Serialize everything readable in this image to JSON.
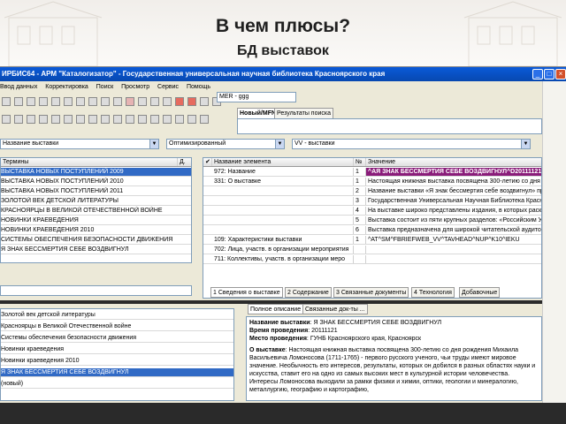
{
  "slide": {
    "title": "В чем плюсы?",
    "subtitle": "БД выставок"
  },
  "window": {
    "title": "ИРБИС64 - АРМ \"Каталогизатор\" - Государственная универсальная научная библиотека Красноярского края"
  },
  "menu": [
    "Ввод данных",
    "Корректировка",
    "Поиск",
    "Просмотр",
    "Сервис",
    "Помощь"
  ],
  "toolbar": {
    "db_field": "MER - ggg",
    "tab_new": "Новый/MFN",
    "tab_results": "Результаты поиска",
    "left_combo": "Название выставки",
    "mid_combo": "Оптимизированный",
    "right_combo": "VV - выставки"
  },
  "terms": {
    "header": "Термины",
    "header_d": "Д.",
    "items": [
      "ВЫСТАВКА НОВЫХ ПОСТУПЛЕНИЙ 2009",
      "ВЫСТАВКА НОВЫХ ПОСТУПЛЕНИЙ 2010",
      "ВЫСТАВКА НОВЫХ ПОСТУПЛЕНИЙ 2011",
      "ЗОЛОТОЙ ВЕК ДЕТСКОЙ ЛИТЕРАТУРЫ",
      "КРАСНОЯРЦЫ В ВЕЛИКОЙ ОТЕЧЕСТВЕННОЙ ВОЙНЕ",
      "НОВИНКИ КРАЕВЕДЕНИЯ",
      "НОВИНКИ КРАЕВЕДЕНИЯ 2010",
      "СИСТЕМЫ ОБЕСПЕЧЕНИЯ БЕЗОПАСНОСТИ ДВИЖЕНИЯ",
      "Я ЗНАК БЕССМЕРТИЯ СЕБЕ ВОЗДВИГНУЛ"
    ]
  },
  "editor": {
    "col_name": "Название элемента",
    "col_num": "№",
    "col_value": "Значение",
    "rows": [
      {
        "name": "972: Название",
        "num": "1",
        "value": "^AЯ ЗНАК БЕССМЕРТИЯ СЕБЕ ВОЗДВИГНУЛ^D20111121^F2011"
      },
      {
        "name": "331: О выставке",
        "num": "1",
        "value": "Настоящая книжная выставка посвящена 300-летию со дня рожд"
      },
      {
        "name": "",
        "num": "2",
        "value": "Название выставки «Я знак бессмертия себе воздвигнул» представл"
      },
      {
        "name": "",
        "num": "3",
        "value": "Государственная Универсальная Научная Библиотека Красноярско"
      },
      {
        "name": "",
        "num": "4",
        "value": "На выставке широко представлены издания, в которых раскрывает"
      },
      {
        "name": "",
        "num": "5",
        "value": "Выставка состоит из пяти крупных разделов: «Российским Ученым"
      },
      {
        "name": "",
        "num": "6",
        "value": "Выставка предназначена для широкой читательской аудитории."
      },
      {
        "name": "109: Характеристики выставки",
        "num": "1",
        "value": "^AT^SM^FBRIEFWEB_VV^TAVHEAD^NUP^K10^IEKU"
      },
      {
        "name": "702: Лица, участв. в организации мероприятия",
        "num": "",
        "value": ""
      },
      {
        "name": "711: Коллективы, участв. в организации меро",
        "num": "",
        "value": ""
      }
    ],
    "tabs": [
      "1 Сведения о выставке",
      "2 Содержание",
      "3 Связанные документы",
      "4 Технология",
      "Добавочные"
    ]
  },
  "records": {
    "items": [
      "Золотой век детской литературы",
      "Красноярцы в Великой Отечественной войне",
      "Системы обеспечения безопасности движения",
      "Новинки краеведения",
      "Новинки краеведения 2010",
      "Я ЗНАК БЕССМЕРТИЯ СЕБЕ ВОЗДВИГНУЛ",
      "(новый)"
    ]
  },
  "preview": {
    "tab_full": "Полное описание",
    "tab_linked": "Связанные док-ты ...",
    "name_label": "Название выставки",
    "name_value": "Я ЗНАК БЕССМЕРТИЯ СЕБЕ ВОЗДВИГНУЛ",
    "time_label": "Время проведения",
    "time_value": "20111121",
    "place_label": "Место проведения",
    "place_value": "ГУНБ Красноярского края, Красноярск",
    "about_label": "О выставке",
    "about_value": "Настоящая книжная выставка посвящена 300-летию со дня рождения Михаила Васильевича Ломоносова (1711-1765) - первого русского ученого, чьи труды имеют мировое значение. Необычность его интересов, результаты, которых он добился в разных областях науки и искусства, ставит его на одно из самых высоких мест в культурной истории человечества. Интересы Ломоносова выходили за рамки физики и химии, оптики, геологии и минералогию, металлургию, географию и картографию,"
  }
}
